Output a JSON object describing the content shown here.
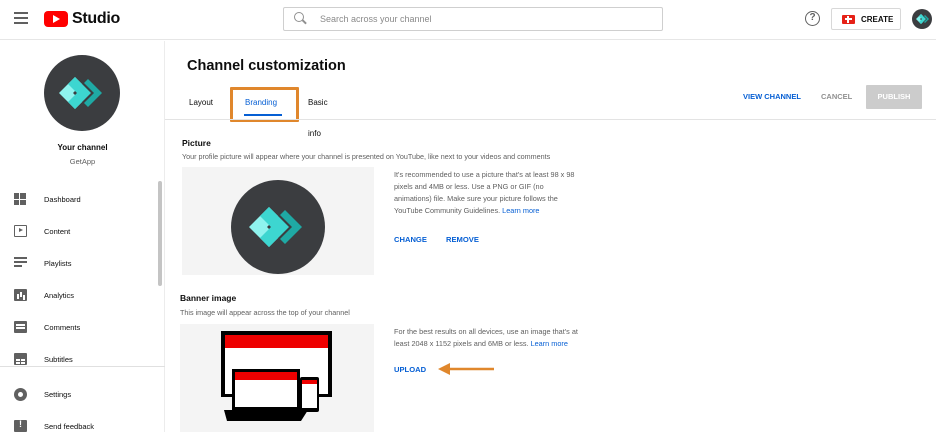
{
  "header": {
    "logo_text": "Studio",
    "search_placeholder": "Search across your channel",
    "help_icon": "?",
    "create_label": "CREATE"
  },
  "sidebar": {
    "channel_title": "Your channel",
    "channel_name": "GetApp",
    "items": [
      {
        "label": "Dashboard",
        "icon": "dashboard-icon"
      },
      {
        "label": "Content",
        "icon": "content-icon"
      },
      {
        "label": "Playlists",
        "icon": "playlists-icon"
      },
      {
        "label": "Analytics",
        "icon": "analytics-icon"
      },
      {
        "label": "Comments",
        "icon": "comments-icon"
      },
      {
        "label": "Subtitles",
        "icon": "subtitles-icon"
      },
      {
        "label": "Settings",
        "icon": "gear-icon"
      },
      {
        "label": "Send feedback",
        "icon": "feedback-icon"
      }
    ]
  },
  "main": {
    "title": "Channel customization",
    "tabs": [
      {
        "label": "Layout",
        "active": false
      },
      {
        "label": "Branding",
        "active": true
      },
      {
        "label": "Basic info",
        "active": false
      }
    ],
    "actions": {
      "view_channel": "VIEW CHANNEL",
      "cancel": "CANCEL",
      "publish": "PUBLISH"
    },
    "picture": {
      "title": "Picture",
      "description": "Your profile picture will appear where your channel is presented on YouTube, like next to your videos and comments",
      "info_lines": [
        "It's recommended to use a picture that's at least 98 x 98",
        "pixels and 4MB or less. Use a PNG or GIF (no",
        "animations) file. Make sure your picture follows the",
        "YouTube Community Guidelines."
      ],
      "learn_more": "Learn more",
      "change": "CHANGE",
      "remove": "REMOVE"
    },
    "banner": {
      "title": "Banner image",
      "description": "This image will appear across the top of your channel",
      "info_lines": [
        "For the best results on all devices, use an image that's at",
        "least 2048 x 1152 pixels and 6MB or less."
      ],
      "learn_more": "Learn more",
      "upload": "UPLOAD"
    }
  },
  "colors": {
    "accent_blue": "#065fd4",
    "annotation_orange": "#e0872c",
    "brand_red": "#ff0000",
    "logo_teal": "#3dd6d0"
  }
}
